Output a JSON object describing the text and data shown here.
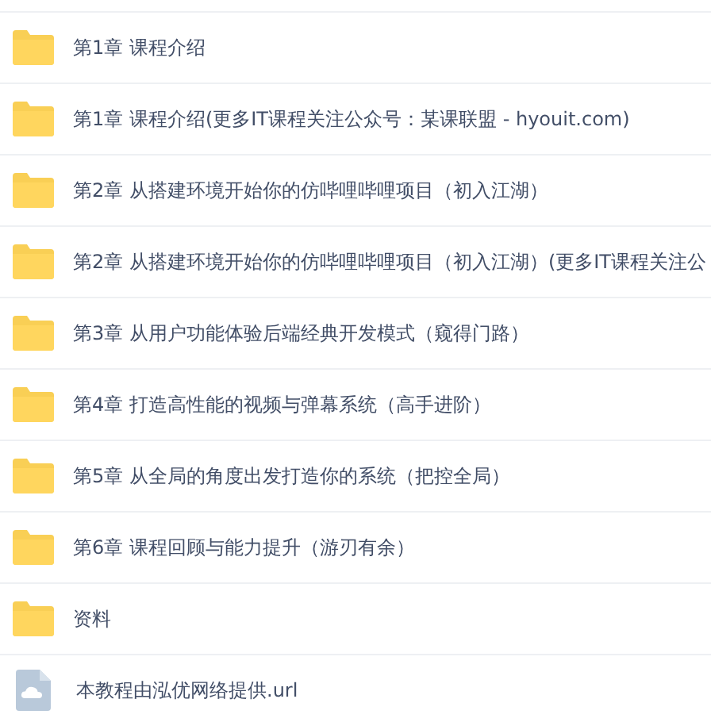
{
  "files": [
    {
      "kind": "folder",
      "name": "第1章 课程介绍"
    },
    {
      "kind": "folder",
      "name": "第1章 课程介绍(更多IT课程关注公众号：某课联盟 - hyouit.com)"
    },
    {
      "kind": "folder",
      "name": "第2章 从搭建环境开始你的仿哔哩哔哩项目（初入江湖）"
    },
    {
      "kind": "folder",
      "name": "第2章 从搭建环境开始你的仿哔哩哔哩项目（初入江湖）(更多IT课程关注公"
    },
    {
      "kind": "folder",
      "name": "第3章 从用户功能体验后端经典开发模式（窥得门路）"
    },
    {
      "kind": "folder",
      "name": "第4章 打造高性能的视频与弹幕系统（高手进阶）"
    },
    {
      "kind": "folder",
      "name": "第5章 从全局的角度出发打造你的系统（把控全局）"
    },
    {
      "kind": "folder",
      "name": "第6章 课程回顾与能力提升（游刃有余）"
    },
    {
      "kind": "folder",
      "name": "资料"
    },
    {
      "kind": "link",
      "name": "本教程由泓优网络提供.url"
    }
  ]
}
